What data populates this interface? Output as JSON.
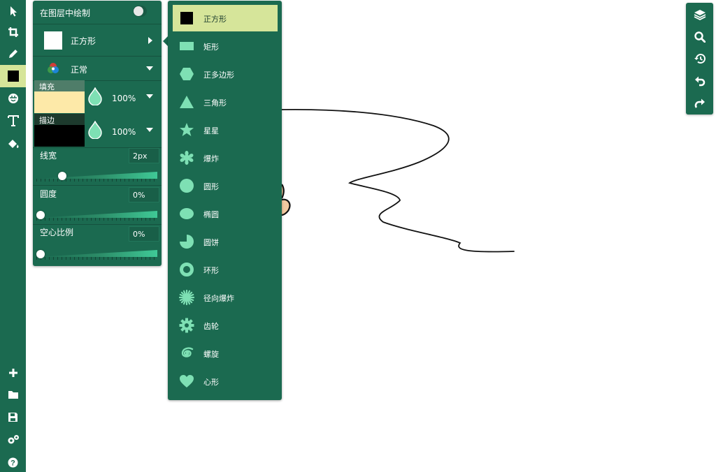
{
  "colors": {
    "toolbar_bg": "#1b6a50",
    "selected_bg": "#d6e59a",
    "icon_mint": "#7ee0b4",
    "fill_color": "#fde9a8",
    "stroke_color": "#000000"
  },
  "left_toolbar": {
    "tools": [
      {
        "name": "pointer-icon",
        "active": false
      },
      {
        "name": "crop-icon",
        "active": false
      },
      {
        "name": "pencil-icon",
        "active": false
      },
      {
        "name": "shape-tool-icon",
        "active": true
      },
      {
        "name": "sticker-icon",
        "active": false
      },
      {
        "name": "text-icon",
        "active": false
      },
      {
        "name": "fill-bucket-icon",
        "active": false
      }
    ],
    "bottom_tools": [
      {
        "name": "add-icon"
      },
      {
        "name": "folder-icon"
      },
      {
        "name": "save-icon"
      },
      {
        "name": "settings-icon"
      },
      {
        "name": "help-icon"
      }
    ]
  },
  "options": {
    "draw_in_layer_label": "在图层中绘制",
    "draw_in_layer_on": false,
    "shape_label": "正方形",
    "blend_label": "正常",
    "fill_label": "填充",
    "stroke_label": "描边",
    "fill_opacity": "100%",
    "stroke_opacity": "100%",
    "line_width_label": "线宽",
    "line_width_value": "2px",
    "line_width_fraction": 0.19,
    "roundness_label": "圆度",
    "roundness_value": "0%",
    "roundness_fraction": 0,
    "hollow_label": "空心比例",
    "hollow_value": "0%",
    "hollow_fraction": 0
  },
  "shape_menu": {
    "items": [
      {
        "label": "正方形",
        "icon": "square-icon",
        "selected": true
      },
      {
        "label": "矩形",
        "icon": "rectangle-icon",
        "selected": false
      },
      {
        "label": "正多边形",
        "icon": "hexagon-icon",
        "selected": false
      },
      {
        "label": "三角形",
        "icon": "triangle-icon",
        "selected": false
      },
      {
        "label": "星星",
        "icon": "star-icon",
        "selected": false
      },
      {
        "label": "爆炸",
        "icon": "explosion-icon",
        "selected": false
      },
      {
        "label": "圆形",
        "icon": "circle-icon",
        "selected": false
      },
      {
        "label": "椭圆",
        "icon": "ellipse-icon",
        "selected": false
      },
      {
        "label": "圆饼",
        "icon": "pie-icon",
        "selected": false
      },
      {
        "label": "环形",
        "icon": "ring-icon",
        "selected": false
      },
      {
        "label": "径向爆炸",
        "icon": "radial-burst-icon",
        "selected": false
      },
      {
        "label": "齿轮",
        "icon": "gear-shape-icon",
        "selected": false
      },
      {
        "label": "螺旋",
        "icon": "spiral-icon",
        "selected": false
      },
      {
        "label": "心形",
        "icon": "heart-icon",
        "selected": false
      }
    ]
  },
  "right_toolbar": {
    "tools": [
      {
        "name": "layers-icon"
      },
      {
        "name": "zoom-icon"
      },
      {
        "name": "history-icon"
      },
      {
        "name": "undo-icon"
      },
      {
        "name": "redo-icon"
      }
    ]
  }
}
